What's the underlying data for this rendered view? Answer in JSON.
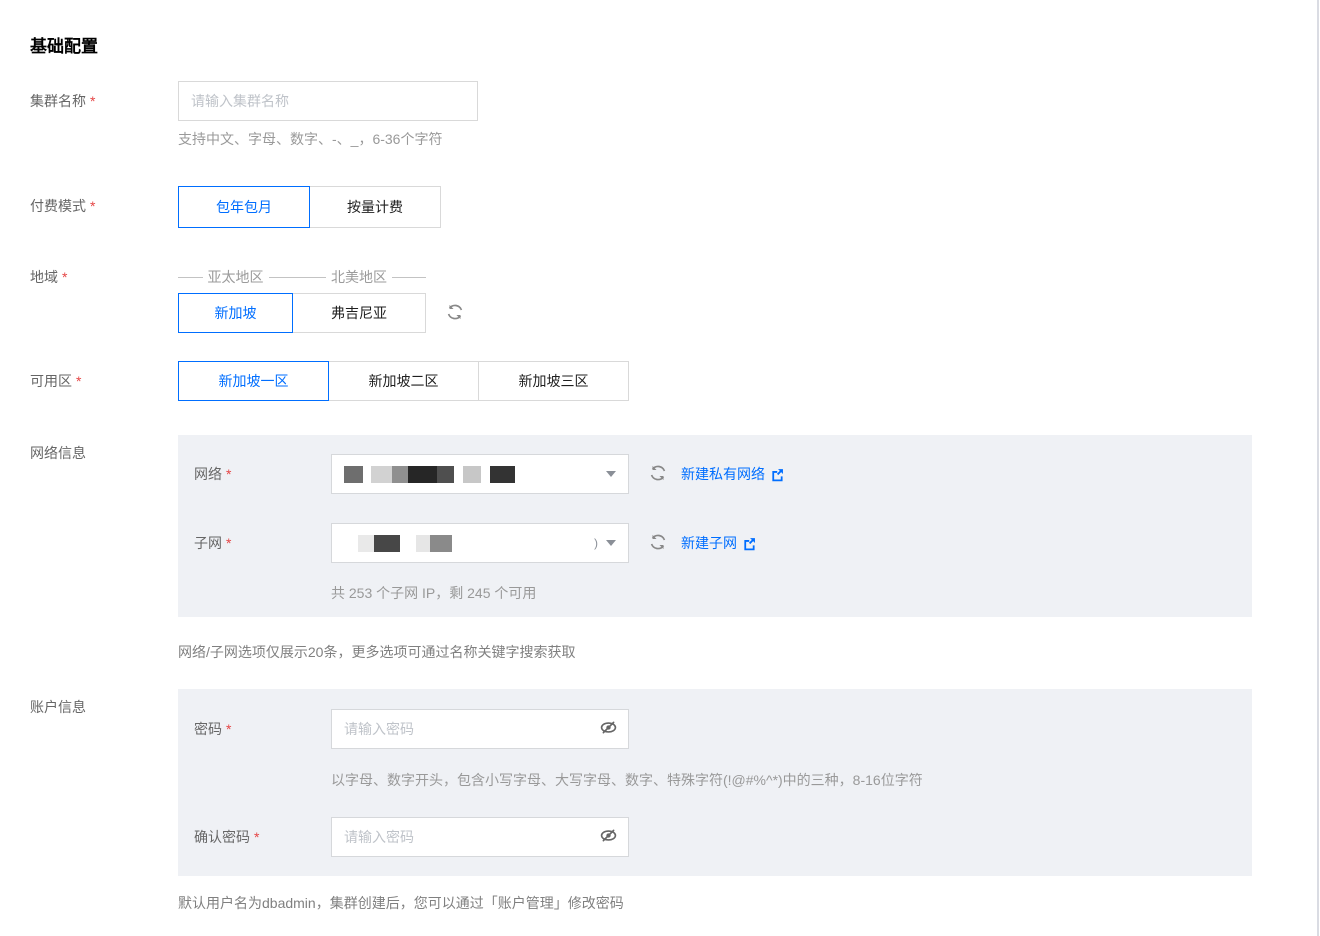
{
  "required_mark": "*",
  "accent_color": "#006eff",
  "panel_bg": "#eff1f5",
  "title": "基础配置",
  "fields": {
    "cluster_name": {
      "label": "集群名称",
      "placeholder": "请输入集群名称",
      "hint": "支持中文、字母、数字、-、_，6-36个字符"
    },
    "pay_mode": {
      "label": "付费模式",
      "options": [
        {
          "label": "包年包月",
          "selected": true
        },
        {
          "label": "按量计费",
          "selected": false
        }
      ]
    },
    "region": {
      "label": "地域",
      "groups": [
        {
          "name": "亚太地区"
        },
        {
          "name": "北美地区"
        }
      ],
      "options": [
        {
          "label": "新加坡",
          "selected": true
        },
        {
          "label": "弗吉尼亚",
          "selected": false
        }
      ]
    },
    "zone": {
      "label": "可用区",
      "options": [
        {
          "label": "新加坡一区",
          "selected": true
        },
        {
          "label": "新加坡二区",
          "selected": false
        },
        {
          "label": "新加坡三区",
          "selected": false
        }
      ]
    },
    "network_info": {
      "label": "网络信息",
      "vpc": {
        "label": "网络",
        "create_link": "新建私有网络"
      },
      "subnet": {
        "label": "子网",
        "create_link": "新建子网",
        "visible_fragment": ")",
        "ip_hint": "共 253 个子网 IP，剩 245 个可用"
      },
      "note": "网络/子网选项仅展示20条，更多选项可通过名称关键字搜索获取"
    },
    "account_info": {
      "label": "账户信息",
      "password": {
        "label": "密码",
        "placeholder": "请输入密码",
        "hint": "以字母、数字开头，包含小写字母、大写字母、数字、特殊字符(!@#%^*)中的三种，8-16位字符"
      },
      "confirm_password": {
        "label": "确认密码",
        "placeholder": "请输入密码"
      },
      "note": "默认用户名为dbadmin，集群创建后，您可以通过「账户管理」修改密码"
    }
  }
}
